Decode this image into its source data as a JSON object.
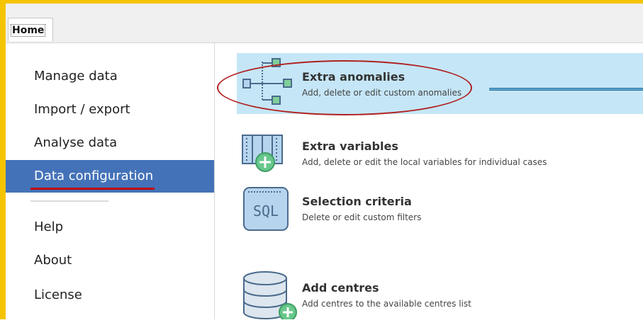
{
  "tabs": {
    "home": "Home"
  },
  "sidebar": {
    "items": [
      {
        "label": "Manage data"
      },
      {
        "label": "Import / export"
      },
      {
        "label": "Analyse data"
      },
      {
        "label": "Data configuration"
      },
      {
        "label": "Help"
      },
      {
        "label": "About"
      },
      {
        "label": "License"
      }
    ],
    "active_index": 3
  },
  "main": {
    "rows": [
      {
        "title": "Extra anomalies",
        "description": "Add, delete or edit custom anomalies",
        "icon": "tree-structure-icon",
        "selected": true
      },
      {
        "title": "Extra variables",
        "description": "Add, delete or edit the local variables for individual cases",
        "icon": "table-columns-add-icon"
      },
      {
        "title": "Selection criteria",
        "description": "Delete or edit custom filters",
        "icon": "sql-document-icon",
        "icon_text": "SQL"
      },
      {
        "title": "Add centres",
        "description": "Add centres to the available centres list",
        "icon": "database-add-icon"
      }
    ]
  },
  "colors": {
    "frame_highlight": "#f5c400",
    "sidebar_active": "#4472b8",
    "row_selected": "#c5e6f7",
    "annotation": "#b02020"
  }
}
